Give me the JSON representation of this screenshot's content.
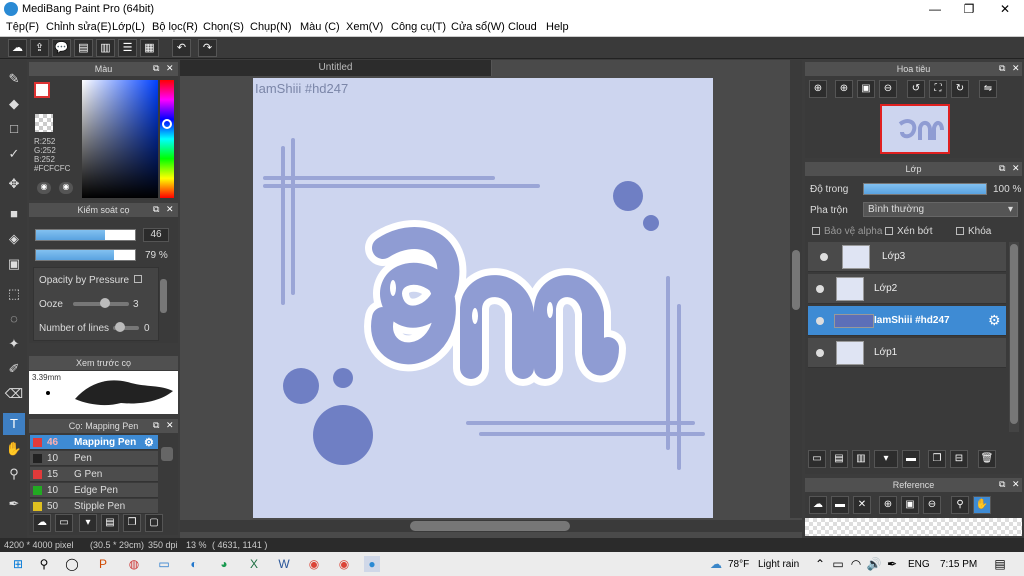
{
  "app": {
    "title": "MediBang Paint Pro (64bit)",
    "minimize": "—",
    "maximize": "❐",
    "close": "✕"
  },
  "menu": [
    "Tệp(F)",
    "Chỉnh sửa(E)",
    "Lớp(L)",
    "Bộ lọc(R)",
    "Chọn(S)",
    "Chụp(N)",
    "Màu (C)",
    "Xem(V)",
    "Công cụ(T)",
    "Cửa sổ(W)",
    "Cloud",
    "Help"
  ],
  "color_panel": {
    "title": "Màu",
    "r": "R:252",
    "g": "G:252",
    "b": "B:252",
    "hex": "#FCFCFC"
  },
  "brush_control": {
    "title": "Kiểm soát cọ",
    "size": "46",
    "opacity": "79 %",
    "size_fill": 0.7,
    "opacity_fill": 0.79,
    "opacity_pressure": "Opacity by Pressure",
    "ooze_label": "Ooze",
    "ooze": "3",
    "lines_label": "Number of lines",
    "lines": "0"
  },
  "preview": {
    "title": "Xem trước cọ",
    "size": "3.39mm"
  },
  "brushes": {
    "title": "Cọ: Mapping Pen",
    "items": [
      {
        "size": "46",
        "name": "Mapping Pen",
        "color": "#e03a3a"
      },
      {
        "size": "10",
        "name": "Pen",
        "color": "#222222"
      },
      {
        "size": "15",
        "name": "G Pen",
        "color": "#e03a3a"
      },
      {
        "size": "10",
        "name": "Edge Pen",
        "color": "#22aa22"
      },
      {
        "size": "50",
        "name": "Stipple Pen",
        "color": "#e0c020"
      }
    ]
  },
  "canvas": {
    "tab": "Untitled",
    "watermark": "IamShiii #hd247",
    "bg": "#cdd5ef"
  },
  "navigator": {
    "title": "Hoa tiêu"
  },
  "layer_panel": {
    "title": "Lớp",
    "opacity_label": "Độ trong",
    "opacity": "100 %",
    "blend_label": "Pha trộn",
    "blend": "Bình thường",
    "protect_alpha": "Bảo vệ alpha",
    "clip": "Xén bớt",
    "lock": "Khóa",
    "layers": [
      "Lớp3",
      "Lớp2",
      "IamShiii #hd247",
      "Lớp1"
    ]
  },
  "reference": {
    "title": "Reference"
  },
  "status": {
    "size": "4200 * 4000 pixel",
    "cm": "(30.5 * 29cm)",
    "dpi": "350 dpi",
    "zoom": "13 %",
    "coords": "( 4631, 1141 )"
  },
  "taskbar": {
    "weather": "78°F",
    "weather_desc": "Light rain",
    "lang": "ENG",
    "time": "7:15 PM"
  }
}
